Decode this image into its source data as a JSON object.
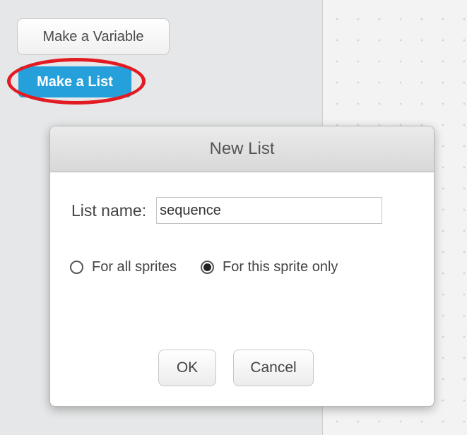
{
  "palette": {
    "make_variable_label": "Make a Variable",
    "make_list_label": "Make a List"
  },
  "dialog": {
    "title": "New List",
    "name_label": "List name:",
    "name_value": "sequence",
    "scope_options": [
      {
        "label": "For all sprites",
        "selected": false
      },
      {
        "label": "For this sprite only",
        "selected": true
      }
    ],
    "ok_label": "OK",
    "cancel_label": "Cancel"
  },
  "colors": {
    "make_list_button": "#25a0da",
    "highlight_ring": "#e21b22"
  }
}
